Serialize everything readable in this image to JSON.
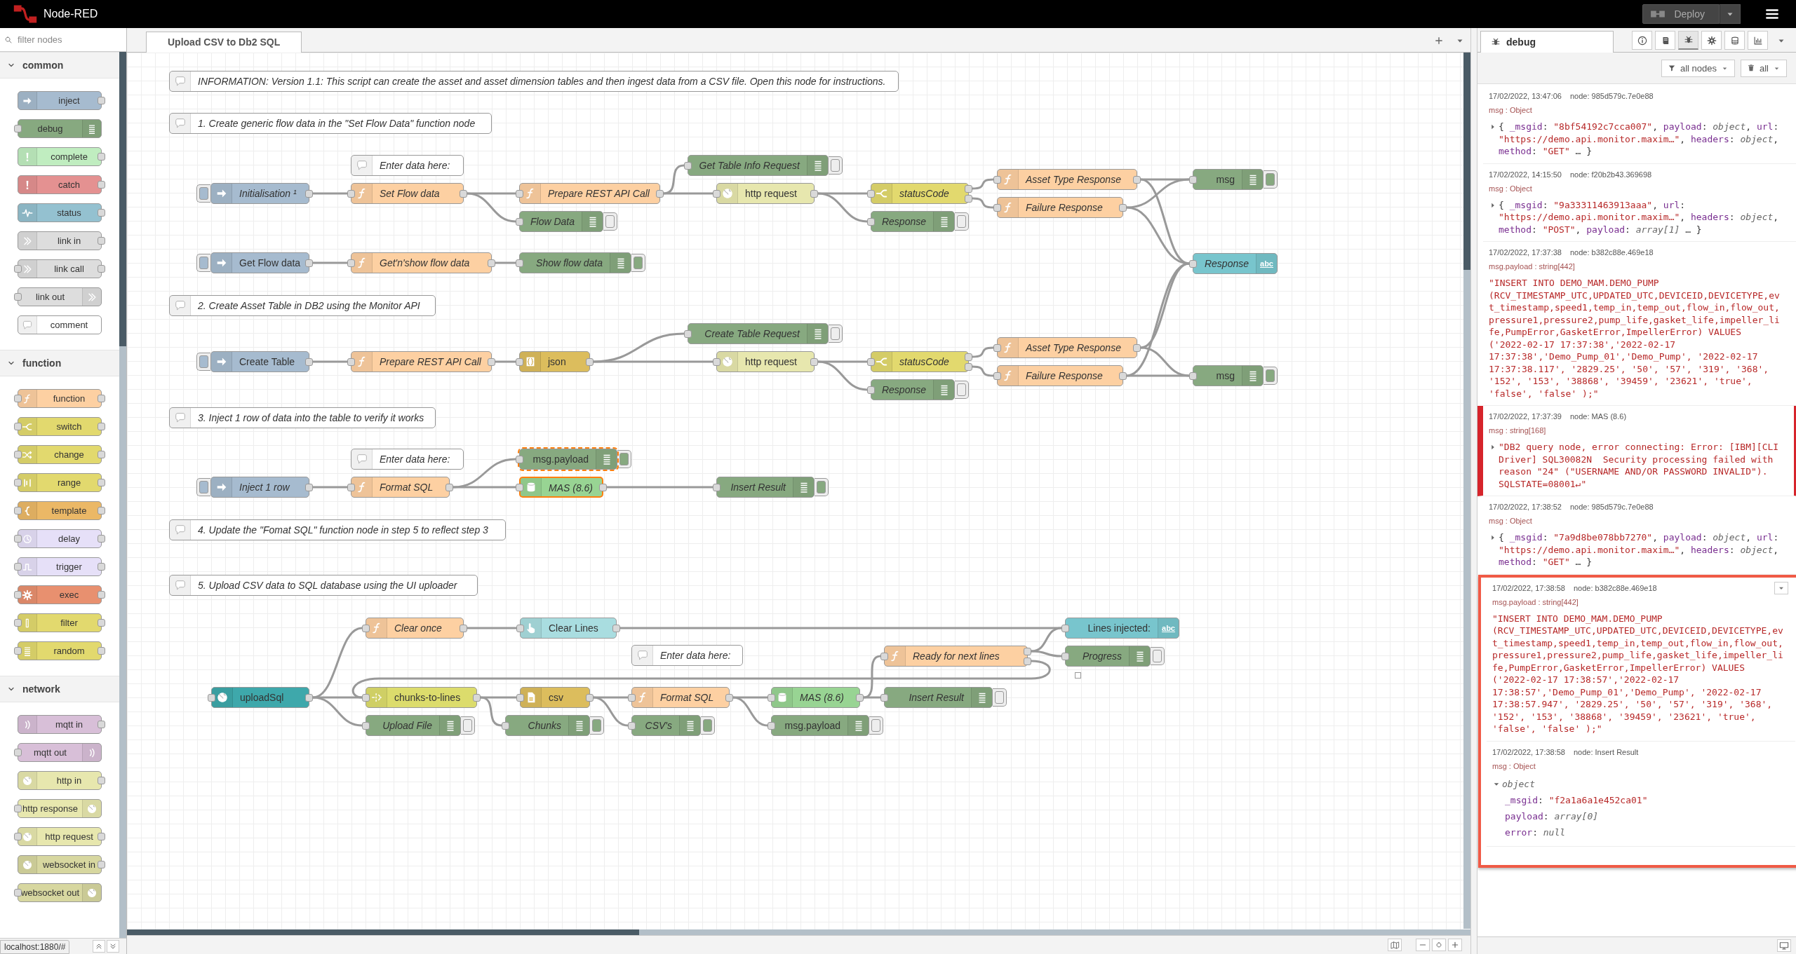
{
  "header": {
    "title": "Node-RED",
    "deploy": "Deploy"
  },
  "palette": {
    "filter_placeholder": "filter nodes",
    "categories": [
      {
        "name": "common",
        "expanded": true,
        "nodes": [
          {
            "label": "inject",
            "kind": "inject"
          },
          {
            "label": "debug",
            "kind": "debug"
          },
          {
            "label": "complete",
            "kind": "complete"
          },
          {
            "label": "catch",
            "kind": "catch"
          },
          {
            "label": "status",
            "kind": "status"
          },
          {
            "label": "link in",
            "kind": "link_in"
          },
          {
            "label": "link call",
            "kind": "link_call"
          },
          {
            "label": "link out",
            "kind": "link_out"
          },
          {
            "label": "comment",
            "kind": "comment"
          }
        ]
      },
      {
        "name": "function",
        "expanded": true,
        "nodes": [
          {
            "label": "function",
            "kind": "function"
          },
          {
            "label": "switch",
            "kind": "switch"
          },
          {
            "label": "change",
            "kind": "change"
          },
          {
            "label": "range",
            "kind": "range"
          },
          {
            "label": "template",
            "kind": "template"
          },
          {
            "label": "delay",
            "kind": "delay"
          },
          {
            "label": "trigger",
            "kind": "trigger"
          },
          {
            "label": "exec",
            "kind": "exec"
          },
          {
            "label": "filter",
            "kind": "filter"
          },
          {
            "label": "random",
            "kind": "random"
          }
        ]
      },
      {
        "name": "network",
        "expanded": true,
        "nodes": [
          {
            "label": "mqtt in",
            "kind": "mqtt_in"
          },
          {
            "label": "mqtt out",
            "kind": "mqtt_out"
          },
          {
            "label": "http in",
            "kind": "http_in"
          },
          {
            "label": "http response",
            "kind": "http_response"
          },
          {
            "label": "http request",
            "kind": "http_request"
          },
          {
            "label": "websocket in",
            "kind": "websocket_in"
          },
          {
            "label": "websocket out",
            "kind": "websocket_out"
          }
        ]
      }
    ]
  },
  "status_url": "localhost:1880/#",
  "workspace_tabs": [
    {
      "label": "Upload CSV to Db2 SQL",
      "selected": true
    }
  ],
  "canvas": {
    "nodes": [
      {
        "kind": "comment",
        "label": "INFORMATION: Version 1.1: This script can create the asset and asset dimension tables and then ingest data from a CSV file. Open this node for instructions.",
        "italic": true,
        "selected": false,
        "highlighted": false
      },
      {
        "kind": "comment",
        "label": "1. Create generic flow data in the \"Set Flow Data\" function node",
        "italic": true,
        "selected": false,
        "highlighted": false
      },
      {
        "kind": "comment",
        "label": "Enter data here:",
        "italic": true,
        "selected": false,
        "highlighted": false
      },
      {
        "kind": "inject",
        "label": "Initialisation ¹",
        "italic": true,
        "selected": false,
        "highlighted": false
      },
      {
        "kind": "function",
        "label": "Set Flow data",
        "italic": true,
        "selected": false,
        "highlighted": false
      },
      {
        "kind": "function",
        "label": "Prepare REST API Call",
        "italic": true,
        "selected": false,
        "highlighted": false
      },
      {
        "kind": "debug",
        "label": "Get Table Info Request",
        "italic": true,
        "selected": false,
        "highlighted": false,
        "active": false,
        "status_marker": false
      },
      {
        "kind": "debug",
        "label": "Flow Data",
        "italic": true,
        "selected": false,
        "highlighted": false,
        "active": false,
        "status_marker": false
      },
      {
        "kind": "http_request",
        "label": "http request",
        "italic": false,
        "selected": false,
        "highlighted": false
      },
      {
        "kind": "switch",
        "label": "statusCode",
        "italic": true,
        "selected": false,
        "highlighted": false
      },
      {
        "kind": "debug",
        "label": "Response",
        "italic": true,
        "selected": false,
        "highlighted": false,
        "active": false,
        "status_marker": false
      },
      {
        "kind": "function",
        "label": "Asset Type Response",
        "italic": true,
        "selected": false,
        "highlighted": false
      },
      {
        "kind": "function",
        "label": "Failure Response",
        "italic": true,
        "selected": false,
        "highlighted": false
      },
      {
        "kind": "debug",
        "label": "msg",
        "italic": false,
        "selected": false,
        "highlighted": false,
        "active": true,
        "status_marker": false
      },
      {
        "kind": "inject",
        "label": "Get Flow data",
        "italic": false,
        "selected": false,
        "highlighted": false
      },
      {
        "kind": "function",
        "label": "Get'n'show flow data",
        "italic": true,
        "selected": false,
        "highlighted": false
      },
      {
        "kind": "debug",
        "label": "Show flow data",
        "italic": true,
        "selected": false,
        "highlighted": false,
        "active": true,
        "status_marker": false
      },
      {
        "kind": "ui_text",
        "label": "Response",
        "icon_text": "abc",
        "italic": true,
        "selected": false,
        "highlighted": false
      },
      {
        "kind": "comment",
        "label": "2. Create Asset Table in DB2 using the Monitor API",
        "italic": true,
        "selected": false,
        "highlighted": false
      },
      {
        "kind": "inject",
        "label": "Create Table",
        "italic": false,
        "selected": false,
        "highlighted": false
      },
      {
        "kind": "function",
        "label": "Prepare REST API Call",
        "italic": true,
        "selected": false,
        "highlighted": false
      },
      {
        "kind": "json",
        "label": "json",
        "italic": false,
        "selected": false,
        "highlighted": false
      },
      {
        "kind": "debug",
        "label": "Create Table Request",
        "italic": true,
        "selected": false,
        "highlighted": false,
        "active": false,
        "status_marker": false
      },
      {
        "kind": "http_request",
        "label": "http request",
        "italic": false,
        "selected": false,
        "highlighted": false
      },
      {
        "kind": "switch",
        "label": "statusCode",
        "italic": true,
        "selected": false,
        "highlighted": false
      },
      {
        "kind": "debug",
        "label": "Response",
        "italic": true,
        "selected": false,
        "highlighted": false,
        "active": false,
        "status_marker": false
      },
      {
        "kind": "function",
        "label": "Asset Type Response",
        "italic": true,
        "selected": false,
        "highlighted": false
      },
      {
        "kind": "function",
        "label": "Failure Response",
        "italic": true,
        "selected": false,
        "highlighted": false
      },
      {
        "kind": "debug",
        "label": "msg",
        "italic": false,
        "selected": false,
        "highlighted": false,
        "active": true,
        "status_marker": false
      },
      {
        "kind": "comment",
        "label": "3. Inject 1 row of data into the table to verify it works",
        "italic": true,
        "selected": false,
        "highlighted": false
      },
      {
        "kind": "comment",
        "label": "Enter data here:",
        "italic": true,
        "selected": false,
        "highlighted": false
      },
      {
        "kind": "inject",
        "label": "Inject 1 row",
        "italic": true,
        "selected": false,
        "highlighted": false
      },
      {
        "kind": "function",
        "label": "Format SQL",
        "italic": true,
        "selected": false,
        "highlighted": false
      },
      {
        "kind": "debug",
        "label": "msg.payload",
        "italic": false,
        "selected": false,
        "highlighted": true,
        "active": true,
        "status_marker": false
      },
      {
        "kind": "db2",
        "label": "MAS (8.6)",
        "italic": true,
        "selected": true,
        "highlighted": false
      },
      {
        "kind": "debug",
        "label": "Insert Result",
        "italic": true,
        "selected": false,
        "highlighted": false,
        "active": true,
        "status_marker": false
      },
      {
        "kind": "comment",
        "label": "4. Update the \"Fomat SQL\" function node in step 5 to reflect step 3",
        "italic": true,
        "selected": false,
        "highlighted": false
      },
      {
        "kind": "comment",
        "label": "5. Upload CSV data to SQL database using the UI uploader",
        "italic": true,
        "selected": false,
        "highlighted": false
      },
      {
        "kind": "function",
        "label": "Clear once",
        "italic": true,
        "selected": false,
        "highlighted": false
      },
      {
        "kind": "ui_button",
        "label": "Clear Lines",
        "italic": false,
        "selected": false,
        "highlighted": false
      },
      {
        "kind": "ui_text",
        "label": "Lines injected:",
        "icon_text": "abc",
        "italic": false,
        "selected": false,
        "highlighted": false
      },
      {
        "kind": "comment",
        "label": "Enter data here:",
        "italic": true,
        "selected": false,
        "highlighted": false
      },
      {
        "kind": "function",
        "label": "Ready for next lines",
        "italic": true,
        "selected": false,
        "highlighted": false
      },
      {
        "kind": "debug",
        "label": "Progress",
        "italic": true,
        "selected": false,
        "highlighted": false,
        "active": false,
        "status_marker": true
      },
      {
        "kind": "ui_upload",
        "label": "uploadSql",
        "italic": false,
        "selected": false,
        "highlighted": false
      },
      {
        "kind": "chunks",
        "label": "chunks-to-lines",
        "italic": false,
        "selected": false,
        "highlighted": false
      },
      {
        "kind": "csv",
        "label": "csv",
        "italic": false,
        "selected": false,
        "highlighted": false
      },
      {
        "kind": "function",
        "label": "Format SQL",
        "italic": true,
        "selected": false,
        "highlighted": false
      },
      {
        "kind": "db2",
        "label": "MAS (8.6)",
        "italic": true,
        "selected": false,
        "highlighted": false
      },
      {
        "kind": "debug",
        "label": "Insert Result",
        "italic": true,
        "selected": false,
        "highlighted": false,
        "active": false,
        "status_marker": false
      },
      {
        "kind": "debug",
        "label": "Upload File",
        "italic": true,
        "selected": false,
        "highlighted": false,
        "active": false,
        "status_marker": false
      },
      {
        "kind": "debug",
        "label": "Chunks",
        "italic": true,
        "selected": false,
        "highlighted": false,
        "active": true,
        "status_marker": false
      },
      {
        "kind": "debug",
        "label": "CSV's",
        "italic": true,
        "selected": false,
        "highlighted": false,
        "active": true,
        "status_marker": false
      },
      {
        "kind": "debug",
        "label": "msg.payload",
        "italic": false,
        "selected": false,
        "highlighted": false,
        "active": false,
        "status_marker": false
      }
    ]
  },
  "sidebar": {
    "tab": "debug",
    "buttons": [
      {
        "kind": "info",
        "selected": false
      },
      {
        "kind": "help",
        "selected": false
      },
      {
        "kind": "debug",
        "selected": true
      },
      {
        "kind": "config",
        "selected": false
      },
      {
        "kind": "context",
        "selected": false
      },
      {
        "kind": "dashboard",
        "selected": false
      }
    ],
    "filter": "all nodes",
    "clear": "all",
    "messages": [
      {
        "time": "17/02/2022, 13:47:06",
        "node": "node: 985d579c.7e0e88",
        "type": "msg : Object",
        "error": false,
        "framed": false,
        "hovered": false,
        "body": {
          "kind": "object",
          "expanded": false,
          "tokens": [
            {
              "kind": "plain",
              "text": "{ "
            },
            {
              "kind": "key",
              "text": "_msgid"
            },
            {
              "kind": "plain",
              "text": ": "
            },
            {
              "kind": "str",
              "text": "\"8bf54192c7cca007\""
            },
            {
              "kind": "plain",
              "text": ", "
            },
            {
              "kind": "key",
              "text": "payload"
            },
            {
              "kind": "plain",
              "text": ": "
            },
            {
              "kind": "type",
              "text": "object"
            },
            {
              "kind": "plain",
              "text": ", "
            },
            {
              "kind": "key",
              "text": "url"
            },
            {
              "kind": "plain",
              "text": ": "
            },
            {
              "kind": "str",
              "text": "\"https://demo.api.monitor.maxim…\""
            },
            {
              "kind": "plain",
              "text": ", "
            },
            {
              "kind": "key",
              "text": "headers"
            },
            {
              "kind": "plain",
              "text": ": "
            },
            {
              "kind": "type",
              "text": "object"
            },
            {
              "kind": "plain",
              "text": ", "
            },
            {
              "kind": "key",
              "text": "method"
            },
            {
              "kind": "plain",
              "text": ": "
            },
            {
              "kind": "str",
              "text": "\"GET\""
            },
            {
              "kind": "plain",
              "text": " … }"
            }
          ]
        }
      },
      {
        "time": "17/02/2022, 14:15:50",
        "node": "node: f20b2b43.369698",
        "type": "msg : Object",
        "error": false,
        "framed": false,
        "hovered": false,
        "body": {
          "kind": "object",
          "expanded": false,
          "tokens": [
            {
              "kind": "plain",
              "text": "{ "
            },
            {
              "kind": "key",
              "text": "_msgid"
            },
            {
              "kind": "plain",
              "text": ": "
            },
            {
              "kind": "str",
              "text": "\"9a33311463913aaa\""
            },
            {
              "kind": "plain",
              "text": ", "
            },
            {
              "kind": "key",
              "text": "url"
            },
            {
              "kind": "plain",
              "text": ": "
            },
            {
              "kind": "str",
              "text": "\"https://demo.api.monitor.maxim…\""
            },
            {
              "kind": "plain",
              "text": ", "
            },
            {
              "kind": "key",
              "text": "headers"
            },
            {
              "kind": "plain",
              "text": ": "
            },
            {
              "kind": "type",
              "text": "object"
            },
            {
              "kind": "plain",
              "text": ", "
            },
            {
              "kind": "key",
              "text": "method"
            },
            {
              "kind": "plain",
              "text": ": "
            },
            {
              "kind": "str",
              "text": "\"POST\""
            },
            {
              "kind": "plain",
              "text": ", "
            },
            {
              "kind": "key",
              "text": "payload"
            },
            {
              "kind": "plain",
              "text": ": "
            },
            {
              "kind": "type",
              "text": "array[1]"
            },
            {
              "kind": "plain",
              "text": " … }"
            }
          ]
        }
      },
      {
        "time": "17/02/2022, 17:37:38",
        "node": "node: b382c88e.469e18",
        "type": "msg.payload : string[442]",
        "error": false,
        "framed": false,
        "hovered": false,
        "body": {
          "kind": "string",
          "text": "\"INSERT INTO DEMO_MAM.DEMO_PUMP (RCV_TIMESTAMP_UTC,UPDATED_UTC,DEVICEID,DEVICETYPE,evt_timestamp,speed1,temp_in,temp_out,flow_in,flow_out,pressure1,pressure2,pump_life,gasket_life,impeller_life,PumpError,GasketError,ImpellerError) VALUES ('2022-02-17 17:37:38','2022-02-17 17:37:38','Demo_Pump_01','Demo_Pump', '2022-02-17 17:37:38.117', '2829.25', '50', '57', '319', '368', '152', '153', '38868', '39459', '23621', 'true', 'false', 'false' );\""
        }
      },
      {
        "time": "17/02/2022, 17:37:39",
        "node": "node: MAS (8.6)",
        "type": "msg : string[168]",
        "error": true,
        "framed": false,
        "hovered": false,
        "body": {
          "kind": "string",
          "expanded": false,
          "text": "\"DB2 query node, error connecting: Error: [IBM][CLI Driver] SQL30082N  Security processing failed with reason \"24\" (\"USERNAME AND/OR PASSWORD INVALID\"). SQLSTATE=08001↵\""
        }
      },
      {
        "time": "17/02/2022, 17:38:52",
        "node": "node: 985d579c.7e0e88",
        "type": "msg : Object",
        "error": false,
        "framed": false,
        "hovered": false,
        "body": {
          "kind": "object",
          "expanded": false,
          "tokens": [
            {
              "kind": "plain",
              "text": "{ "
            },
            {
              "kind": "key",
              "text": "_msgid"
            },
            {
              "kind": "plain",
              "text": ": "
            },
            {
              "kind": "str",
              "text": "\"7a9d8be078bb7270\""
            },
            {
              "kind": "plain",
              "text": ", "
            },
            {
              "kind": "key",
              "text": "payload"
            },
            {
              "kind": "plain",
              "text": ": "
            },
            {
              "kind": "type",
              "text": "object"
            },
            {
              "kind": "plain",
              "text": ", "
            },
            {
              "kind": "key",
              "text": "url"
            },
            {
              "kind": "plain",
              "text": ": "
            },
            {
              "kind": "str",
              "text": "\"https://demo.api.monitor.maxim…\""
            },
            {
              "kind": "plain",
              "text": ", "
            },
            {
              "kind": "key",
              "text": "headers"
            },
            {
              "kind": "plain",
              "text": ": "
            },
            {
              "kind": "type",
              "text": "object"
            },
            {
              "kind": "plain",
              "text": ", "
            },
            {
              "kind": "key",
              "text": "method"
            },
            {
              "kind": "plain",
              "text": ": "
            },
            {
              "kind": "str",
              "text": "\"GET\""
            },
            {
              "kind": "plain",
              "text": " … }"
            }
          ]
        }
      },
      {
        "time": "17/02/2022, 17:38:58",
        "node": "node: b382c88e.469e18",
        "type": "msg.payload : string[442]",
        "error": false,
        "framed": true,
        "hovered": true,
        "body": {
          "kind": "string",
          "text": "\"INSERT INTO DEMO_MAM.DEMO_PUMP (RCV_TIMESTAMP_UTC,UPDATED_UTC,DEVICEID,DEVICETYPE,evt_timestamp,speed1,temp_in,temp_out,flow_in,flow_out,pressure1,pressure2,pump_life,gasket_life,impeller_life,PumpError,GasketError,ImpellerError) VALUES ('2022-02-17 17:38:57','2022-02-17 17:38:57','Demo_Pump_01','Demo_Pump', '2022-02-17 17:38:57.947', '2829.25', '50', '57', '319', '368', '152', '153', '38868', '39459', '23621', 'true', 'false', 'false' );\""
        }
      },
      {
        "time": "17/02/2022, 17:38:58",
        "node": "node: Insert Result",
        "type": "msg : Object",
        "error": false,
        "framed": true,
        "hovered": false,
        "body": {
          "kind": "tree",
          "expanded": true,
          "label": "object",
          "props": [
            {
              "tokens": [
                {
                  "kind": "key",
                  "text": "_msgid"
                },
                {
                  "kind": "plain",
                  "text": ": "
                },
                {
                  "kind": "str",
                  "text": "\"f2a1a6a1e452ca01\""
                }
              ]
            },
            {
              "tokens": [
                {
                  "kind": "key",
                  "text": "payload"
                },
                {
                  "kind": "plain",
                  "text": ": "
                },
                {
                  "kind": "type",
                  "text": "array[0]"
                }
              ]
            },
            {
              "tokens": [
                {
                  "kind": "key",
                  "text": "error"
                },
                {
                  "kind": "plain",
                  "text": ": "
                },
                {
                  "kind": "type",
                  "text": "null"
                }
              ]
            }
          ]
        }
      }
    ]
  }
}
